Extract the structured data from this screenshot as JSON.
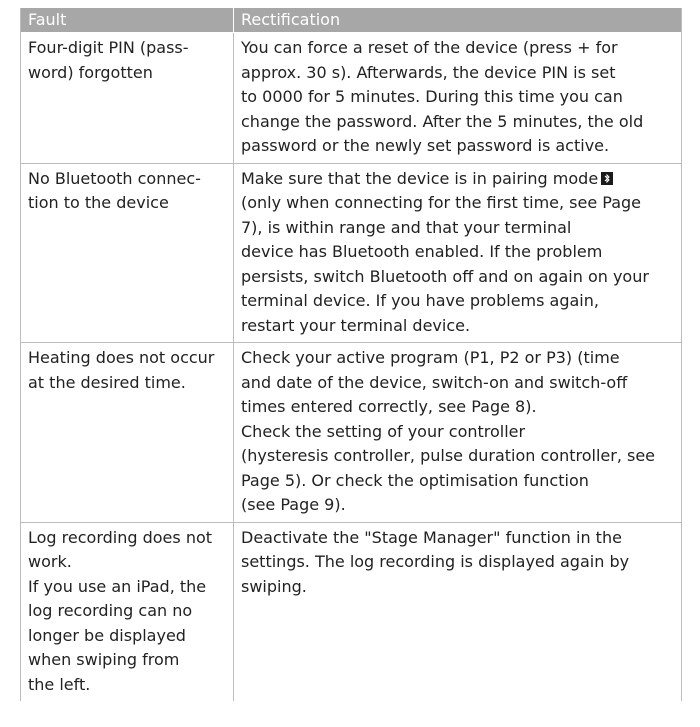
{
  "table": {
    "headers": [
      "Fault",
      "Rectification"
    ],
    "rows": [
      {
        "fault": "Four-digit PIN (pass-\nword) forgotten",
        "rectification": "You can force a reset of the device (press + for\napprox. 30 s). Afterwards, the device PIN is set\nto 0000 for 5 minutes. During this time you can\nchange the password. After the 5 minutes, the old\npassword or the newly set password is active."
      },
      {
        "fault": "No Bluetooth connec-\ntion to the device",
        "rectification_a": "Make sure that the device is in pairing mode",
        "rectification_b": "\n(only when connecting for the first time, see Page\n7), is within range and that your terminal\ndevice has Bluetooth enabled. If the problem\npersists, switch Bluetooth off and on again on your\nterminal device. If you have problems again,\nrestart your terminal device.",
        "icon": "bluetooth-icon"
      },
      {
        "fault": "Heating does not occur\nat the desired time.",
        "rectification": "Check your active program (P1, P2 or P3) (time\nand date of the device, switch-on and switch-off\ntimes entered correctly, see Page 8).\nCheck the setting of your controller\n(hysteresis controller, pulse duration controller, see\nPage 5). Or check the optimisation function\n(see Page 9)."
      },
      {
        "fault": "Log recording does not\nwork.\nIf you use an iPad, the\nlog recording can no\nlonger be displayed\nwhen swiping from\nthe left.",
        "rectification": "Deactivate the \"Stage Manager\" function in the\nsettings. The log recording is displayed again by\nswiping."
      }
    ]
  },
  "colors": {
    "header_bg": "#a7a7a7",
    "border": "#bdbdbd",
    "text": "#222222"
  }
}
